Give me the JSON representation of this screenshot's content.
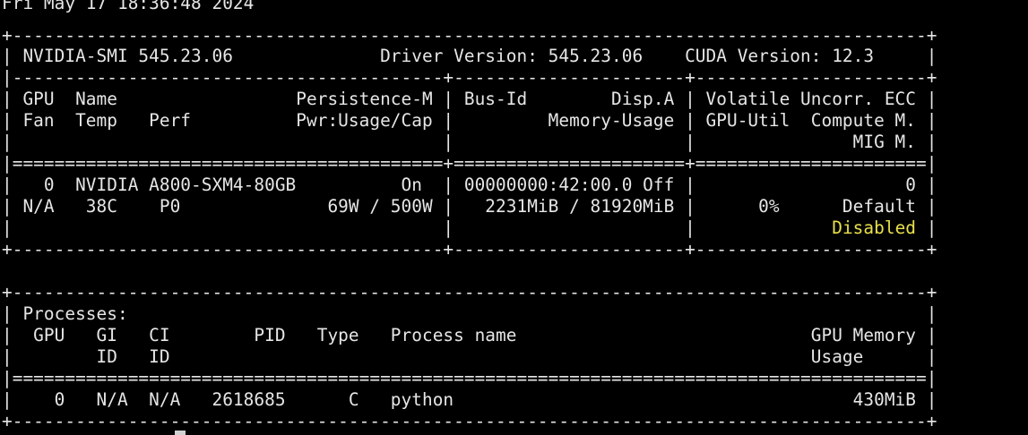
{
  "terminal": {
    "lines": [
      "Fri May 17 18:36:48 2024",
      "+---------------------------------------------------------------------------------------+",
      "| NVIDIA-SMI 545.23.06              Driver Version: 545.23.06    CUDA Version: 12.3     |",
      "|-----------------------------------------+----------------------+----------------------+",
      "| GPU  Name                 Persistence-M | Bus-Id        Disp.A | Volatile Uncorr. ECC |",
      "| Fan  Temp   Perf          Pwr:Usage/Cap |         Memory-Usage | GPU-Util  Compute M. |",
      "|                                         |                      |               MIG M. |",
      "|=========================================+======================+======================|",
      "|   0  NVIDIA A800-SXM4-80GB          On  | 00000000:42:00.0 Off |                    0 |",
      "| N/A   38C    P0              69W / 500W |   2231MiB / 81920MiB |      0%      Default |",
      "|                                         |                      |             ",
      "+-----------------------------------------+----------------------+----------------------+",
      "",
      "+---------------------------------------------------------------------------------------+",
      "| Processes:                                                                            |",
      "|  GPU   GI   CI        PID   Type   Process name                            GPU Memory |",
      "|        ID   ID                                                             Usage      |",
      "|=======================================================================================|",
      "|    0   N/A  N/A   2618685      C   python                                      430MiB |",
      "+---------------------------------------------------------------------------------------+"
    ],
    "mig_disabled": "Disabled",
    "mig_row_end": " |",
    "colors": {
      "background": "#000000",
      "text": "#e6e6e6",
      "highlight": "#e8e04a"
    }
  }
}
